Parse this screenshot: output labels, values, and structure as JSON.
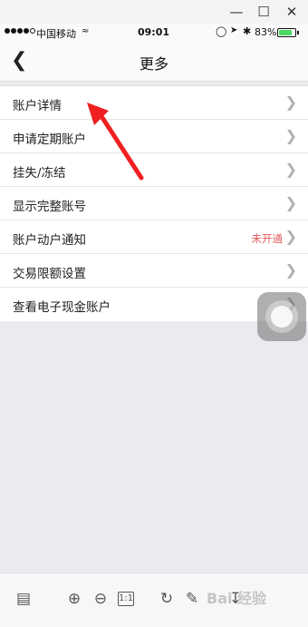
{
  "window": {
    "minimize_icon": "minimize-icon",
    "maximize_icon": "maximize-icon",
    "close_icon": "close-icon"
  },
  "statusbar": {
    "carrier": "中国移动",
    "time": "09:01",
    "battery_percent": "83%",
    "battery_level": 0.83,
    "battery_color": "#4cd964"
  },
  "navbar": {
    "title": "更多",
    "back_icon": "chevron-left-icon"
  },
  "menu": {
    "items": [
      {
        "label": "账户详情",
        "status": ""
      },
      {
        "label": "申请定期账户",
        "status": ""
      },
      {
        "label": "挂失/冻结",
        "status": ""
      },
      {
        "label": "显示完整账号",
        "status": ""
      },
      {
        "label": "账户动户通知",
        "status": "未开通"
      },
      {
        "label": "交易限额设置",
        "status": ""
      },
      {
        "label": "查看电子现金账户",
        "status": ""
      }
    ],
    "status_color": "#e05a5a"
  },
  "annotation": {
    "color": "#f02020"
  },
  "toolbar": {
    "fit_label": "1:1",
    "watermark": "Bai 经验"
  }
}
